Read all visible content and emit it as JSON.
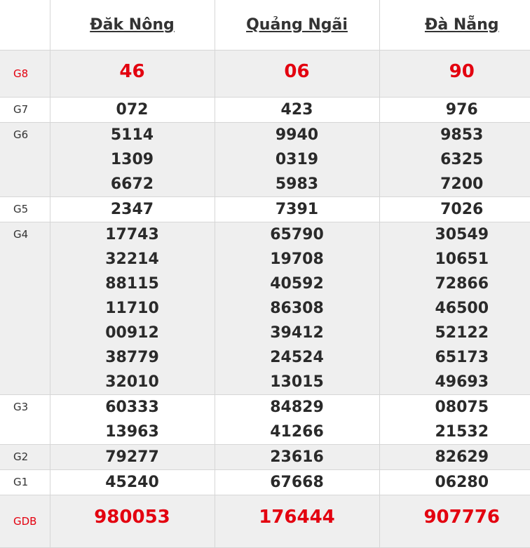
{
  "provinces": [
    "Đăk Nông",
    "Quảng Ngãi",
    "Đà Nẵng"
  ],
  "prizes": [
    {
      "label": "G8",
      "highlight": true,
      "results": [
        [
          "46"
        ],
        [
          "06"
        ],
        [
          "90"
        ]
      ]
    },
    {
      "label": "G7",
      "highlight": false,
      "results": [
        [
          "072"
        ],
        [
          "423"
        ],
        [
          "976"
        ]
      ]
    },
    {
      "label": "G6",
      "highlight": false,
      "results": [
        [
          "5114",
          "1309",
          "6672"
        ],
        [
          "9940",
          "0319",
          "5983"
        ],
        [
          "9853",
          "6325",
          "7200"
        ]
      ]
    },
    {
      "label": "G5",
      "highlight": false,
      "results": [
        [
          "2347"
        ],
        [
          "7391"
        ],
        [
          "7026"
        ]
      ]
    },
    {
      "label": "G4",
      "highlight": false,
      "results": [
        [
          "17743",
          "32214",
          "88115",
          "11710",
          "00912",
          "38779",
          "32010"
        ],
        [
          "65790",
          "19708",
          "40592",
          "86308",
          "39412",
          "24524",
          "13015"
        ],
        [
          "30549",
          "10651",
          "72866",
          "46500",
          "52122",
          "65173",
          "49693"
        ]
      ]
    },
    {
      "label": "G3",
      "highlight": false,
      "results": [
        [
          "60333",
          "13963"
        ],
        [
          "84829",
          "41266"
        ],
        [
          "08075",
          "21532"
        ]
      ]
    },
    {
      "label": "G2",
      "highlight": false,
      "results": [
        [
          "79277"
        ],
        [
          "23616"
        ],
        [
          "82629"
        ]
      ]
    },
    {
      "label": "G1",
      "highlight": false,
      "results": [
        [
          "45240"
        ],
        [
          "67668"
        ],
        [
          "06280"
        ]
      ]
    },
    {
      "label": "GDB",
      "highlight": true,
      "results": [
        [
          "980053"
        ],
        [
          "176444"
        ],
        [
          "907776"
        ]
      ]
    }
  ],
  "colors": {
    "accent_red": "#e3000f",
    "row_gray": "#efefef",
    "text_dark": "#2a2a2a",
    "border": "#d6d6d6"
  }
}
